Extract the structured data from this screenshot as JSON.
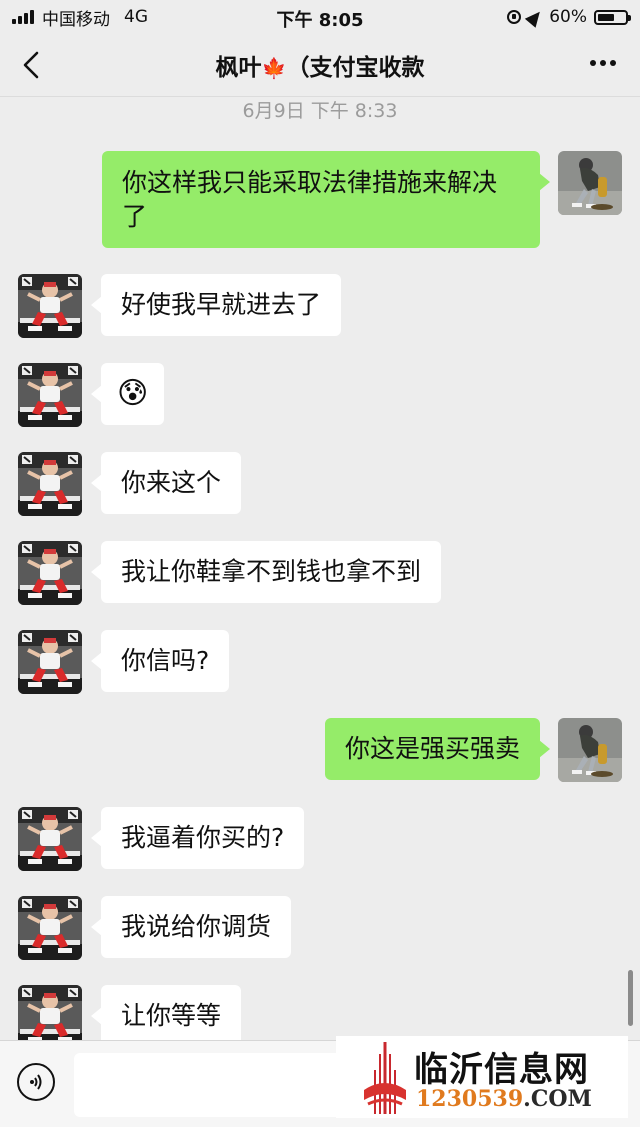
{
  "status_bar": {
    "carrier": "中国移动",
    "network": "4G",
    "time": "下午 8:05",
    "battery": "60%",
    "battery_level": 0.6
  },
  "header": {
    "title": "枫叶",
    "title_leaf": "🍁",
    "title_suffix": "（支付宝收款",
    "back_icon": "chevron-left-icon",
    "more_icon": "ellipsis-icon"
  },
  "timestamp": "6月9日 下午 8:33",
  "messages": [
    {
      "side": "right",
      "text_line1": "你这样我只能采取法律措施来解决",
      "text_line2": "了"
    },
    {
      "side": "left",
      "text": "好使我早就进去了"
    },
    {
      "side": "left",
      "text": "😰"
    },
    {
      "side": "left",
      "text": "你来这个"
    },
    {
      "side": "left",
      "text": "我让你鞋拿不到钱也拿不到"
    },
    {
      "side": "left",
      "text": "你信吗?"
    },
    {
      "side": "right",
      "text": "你这是强买强卖"
    },
    {
      "side": "left",
      "text": "我逼着你买的?"
    },
    {
      "side": "left",
      "text": "我说给你调货"
    },
    {
      "side": "left",
      "text": "让你等等"
    }
  ],
  "input_bar": {
    "voice_icon": "voice-icon",
    "placeholder": ""
  },
  "watermark": {
    "name": "临沂信息网",
    "url_highlight": "1230539",
    "url_suffix": ".COM"
  }
}
